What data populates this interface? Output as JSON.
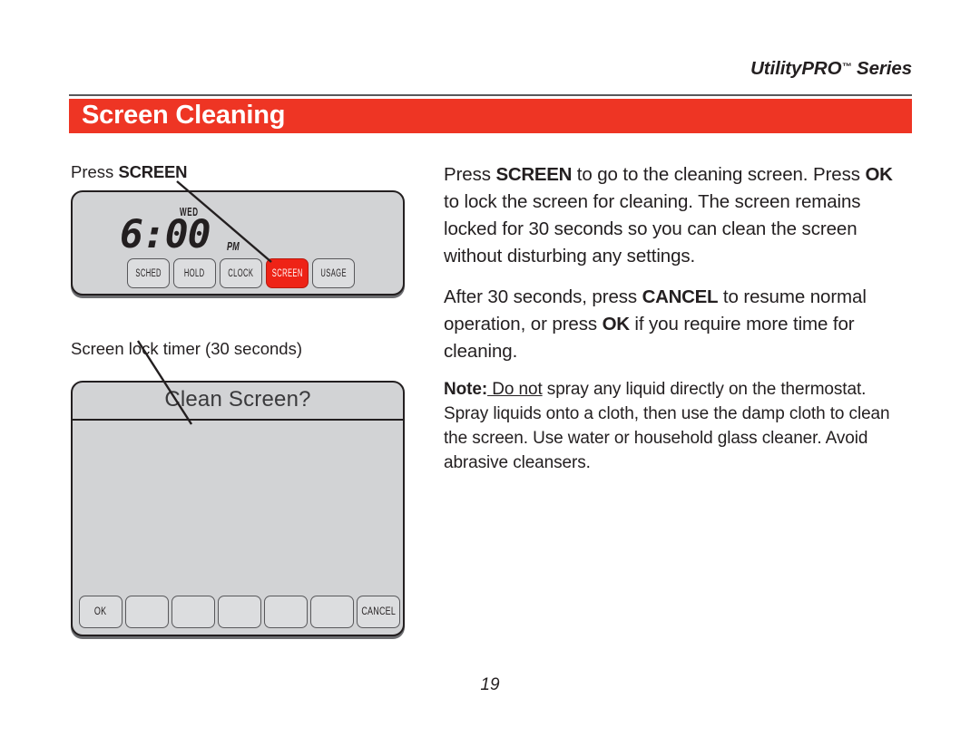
{
  "header": {
    "series_title": "UtilityPRO",
    "trademark": "™",
    "series_word": " Series"
  },
  "title_bar": {
    "page_title": "Screen Cleaning",
    "accent_color": "#ee3524"
  },
  "left_column": {
    "press_screen_label_prefix": "Press ",
    "press_screen_label_key": "SCREEN",
    "timer_label": "Screen lock timer (30 seconds)",
    "thermostat": {
      "lcd_day": "WED",
      "lcd_time": "6:00",
      "lcd_meridiem": "PM",
      "buttons": [
        {
          "label": "SCHED",
          "active": false
        },
        {
          "label": "HOLD",
          "active": false
        },
        {
          "label": "CLOCK",
          "active": false
        },
        {
          "label": "SCREEN",
          "active": true
        },
        {
          "label": "USAGE",
          "active": false
        }
      ],
      "active_button_color": "#ee2316"
    },
    "clean_screen": {
      "header_text": "Clean Screen?",
      "buttons": [
        {
          "label": "OK"
        },
        {
          "label": ""
        },
        {
          "label": ""
        },
        {
          "label": ""
        },
        {
          "label": ""
        },
        {
          "label": ""
        },
        {
          "label": "CANCEL"
        }
      ]
    }
  },
  "right_column": {
    "paragraph_1": {
      "part_1": "Press ",
      "key_1": "SCREEN",
      "part_2": " to go to the cleaning screen. Press ",
      "key_2": "OK",
      "part_3": " to lock the screen for cleaning. The screen remains locked for 30 seconds so you can clean the screen without disturbing any settings."
    },
    "paragraph_2": {
      "part_1": "After 30 seconds, press ",
      "key_1": "CANCEL",
      "part_2": " to resume normal operation, or press ",
      "key_2": "OK",
      "part_3": " if you require more time for cleaning."
    },
    "note_paragraph": {
      "lead": "Note:",
      "underlined": " Do not",
      "rest": " spray any liquid directly on the thermostat. Spray liquids onto a cloth, then use the damp cloth to clean the screen. Use water or household glass cleaner. Avoid abrasive cleansers."
    }
  },
  "footer": {
    "page_number": "19"
  }
}
